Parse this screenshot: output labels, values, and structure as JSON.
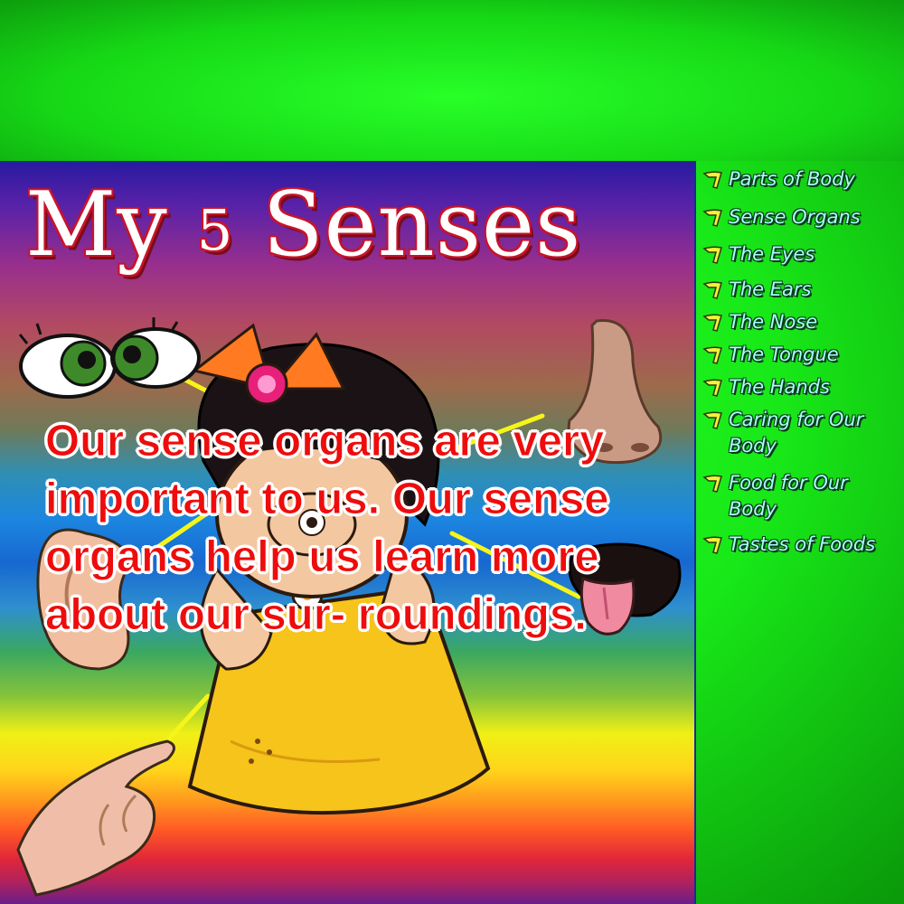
{
  "slide": {
    "title_prefix": "My ",
    "title_digit": "5",
    "title_suffix": " Senses",
    "body_text": "Our sense organs are very important to us. Our sense organs help us learn more about our sur- roundings."
  },
  "sidebar": {
    "items": [
      {
        "label": "Parts of Body"
      },
      {
        "label": "Sense Organs"
      },
      {
        "label": "The Eyes"
      },
      {
        "label": "The Ears"
      },
      {
        "label": "The Nose"
      },
      {
        "label": "The Tongue"
      },
      {
        "label": "The Hands"
      },
      {
        "label": "Caring for Our Body"
      },
      {
        "label": "Food for Our Body"
      },
      {
        "label": "Tastes of Foods"
      }
    ]
  },
  "colors": {
    "frame_green": "#18e818",
    "panel_border": "#1b2a9a",
    "title_fill": "#ffffff",
    "title_outline": "#c8142c",
    "body_text": "#ee0c0c",
    "nav_text": "#a8fff6"
  },
  "icons": {
    "nav_bullet": "yellow-arrow-bullet-icon"
  }
}
